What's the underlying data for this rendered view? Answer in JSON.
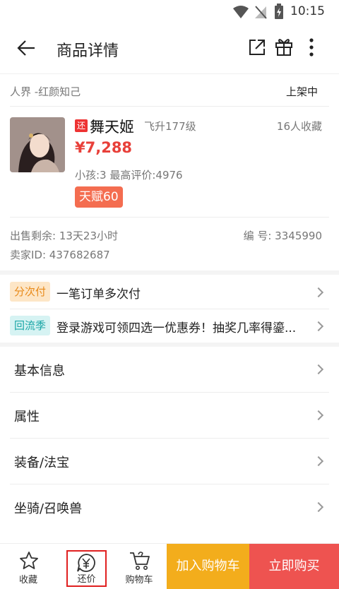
{
  "status_bar": {
    "time": "10:15"
  },
  "header": {
    "title": "商品详情"
  },
  "server": {
    "name": "人界 -红颜知己",
    "status": "上架中"
  },
  "product": {
    "tag": "还",
    "name": "舞天姬",
    "level": "飞升177级",
    "favorites": "16人收藏",
    "price": "¥7,288",
    "meta": "小孩:3 最高评价:4976",
    "talent": "天赋60"
  },
  "sale": {
    "remaining": "出售剩余: 13天23小时",
    "number_label": "编  号: 3345990",
    "seller": "卖家ID: 437682687"
  },
  "promos": [
    {
      "tag": "分次付",
      "text": "一笔订单多次付"
    },
    {
      "tag": "回流季",
      "text": "登录游戏可领四选一优惠券！抽奖几率得鎏..."
    }
  ],
  "sections": [
    "基本信息",
    "属性",
    "装备/法宝",
    "坐骑/召唤兽"
  ],
  "bottom_nav": {
    "favorite": "收藏",
    "bargain": "还价",
    "cart": "购物车",
    "add_to_cart": "加入购物车",
    "buy_now": "立即购买"
  },
  "colors": {
    "price": "#e8403a",
    "cart_button": "#f3ad1c",
    "buy_button": "#ee5350",
    "highlight_box": "#e02020"
  }
}
